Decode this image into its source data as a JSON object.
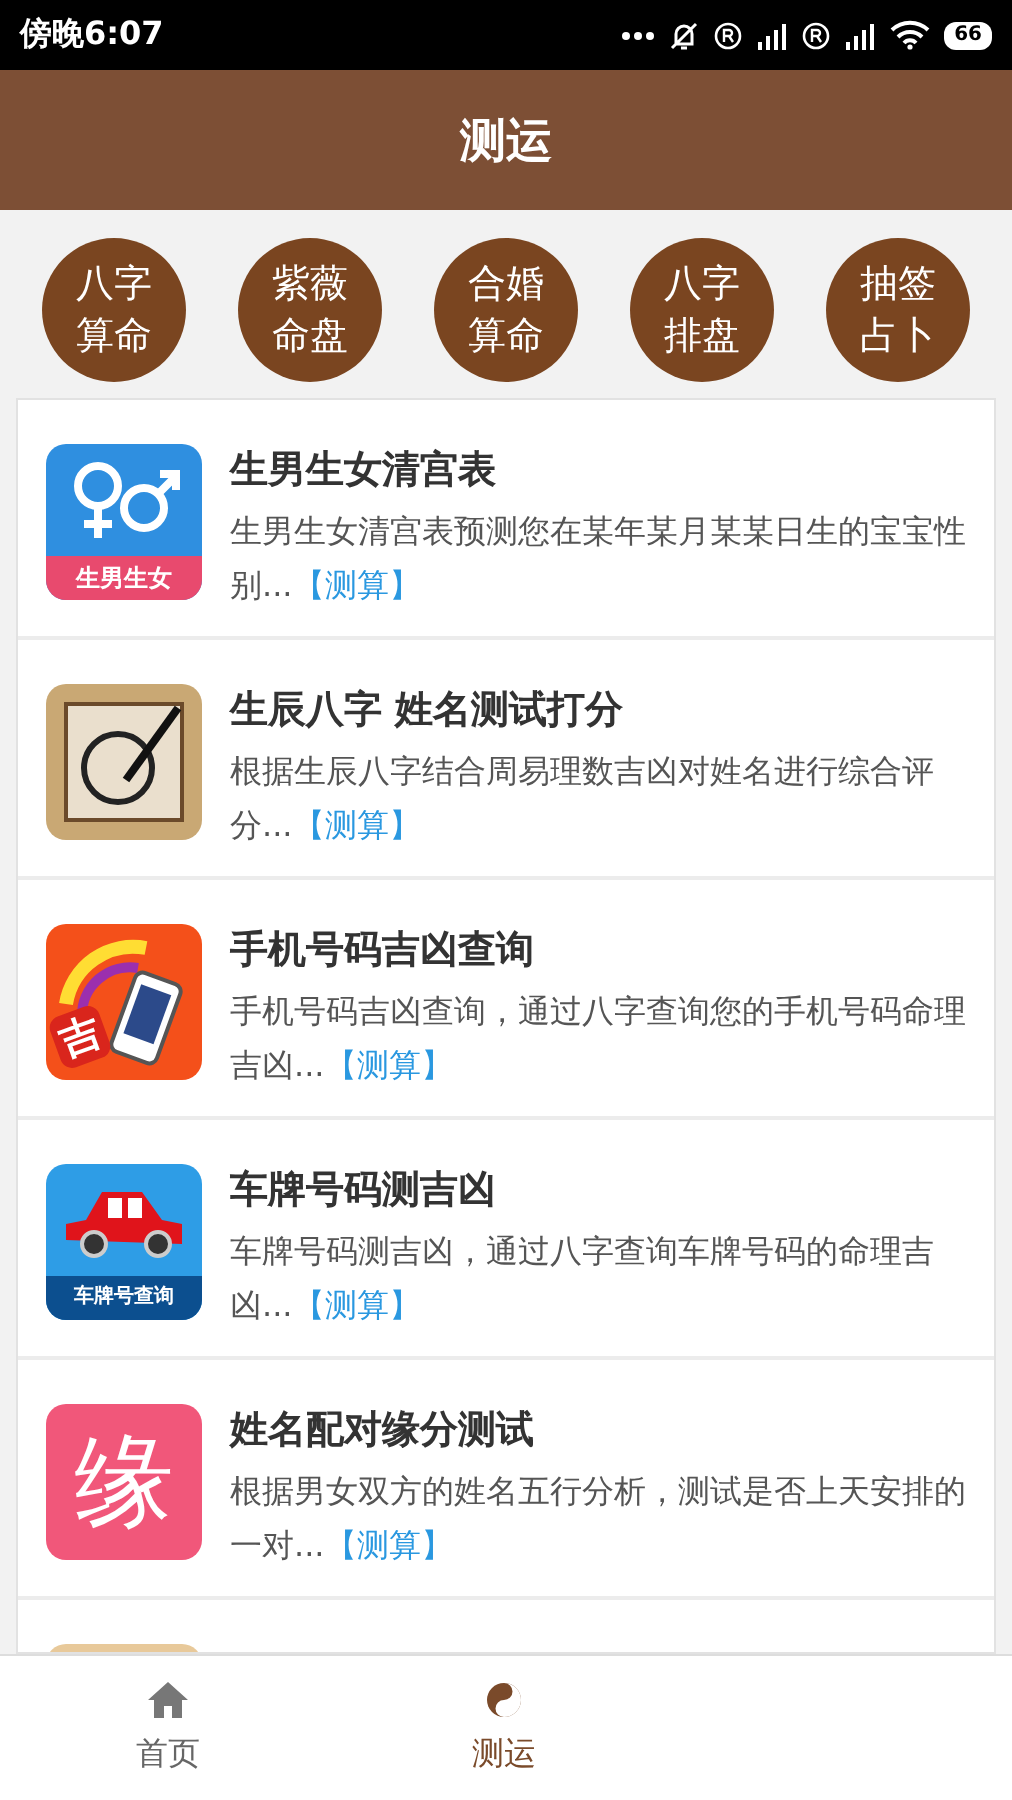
{
  "status_bar": {
    "time": "傍晚6:07",
    "battery": "66"
  },
  "header": {
    "title": "测运"
  },
  "shortcuts": [
    {
      "line1": "八字",
      "line2": "算命"
    },
    {
      "line1": "紫薇",
      "line2": "命盘"
    },
    {
      "line1": "合婚",
      "line2": "算命"
    },
    {
      "line1": "八字",
      "line2": "排盘"
    },
    {
      "line1": "抽签",
      "line2": "占卜"
    }
  ],
  "items": [
    {
      "kind": "gender",
      "icon_label": "生男生女",
      "title": "生男生女清宫表",
      "description": "生男生女清宫表预测您在某年某月某某日生的宝宝性别...",
      "link": "【测算】"
    },
    {
      "kind": "name",
      "title": "生辰八字 姓名测试打分",
      "description": "根据生辰八字结合周易理数吉凶对姓名进行综合评分...",
      "link": "【测算】"
    },
    {
      "kind": "phone",
      "icon_label": "吉",
      "title": "手机号码吉凶查询",
      "description": "手机号码吉凶查询，通过八字查询您的手机号码命理吉凶...",
      "link": "【测算】"
    },
    {
      "kind": "car",
      "icon_label": "车牌号查询",
      "title": "车牌号码测吉凶",
      "description": "车牌号码测吉凶，通过八字查询车牌号码的命理吉凶...",
      "link": "【测算】"
    },
    {
      "kind": "fate",
      "icon_label": "缘",
      "title": "姓名配对缘分测试",
      "description": "根据男女双方的姓名五行分析，测试是否上天安排的一对...",
      "link": "【测算】"
    },
    {
      "kind": "partial"
    }
  ],
  "tabs": [
    {
      "kind": "home",
      "label": "首页",
      "selected": false
    },
    {
      "kind": "yinyang",
      "label": "测运",
      "selected": true
    }
  ]
}
